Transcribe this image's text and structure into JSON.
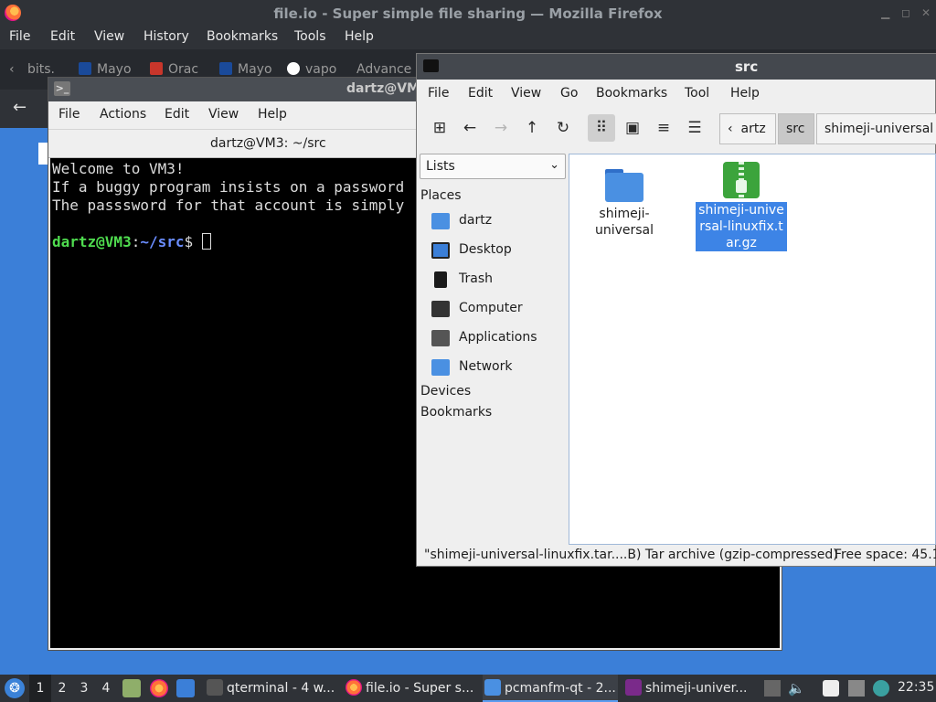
{
  "firefox": {
    "title": "file.io - Super simple file sharing — Mozilla Firefox",
    "menu": [
      "File",
      "Edit",
      "View",
      "History",
      "Bookmarks",
      "Tools",
      "Help"
    ],
    "tabs": [
      "bits.",
      "Mayo",
      "Orac",
      "Mayo",
      "vapo",
      "Advance"
    ]
  },
  "terminal": {
    "window_title": "dartz@VM",
    "menu": [
      "File",
      "Actions",
      "Edit",
      "View",
      "Help"
    ],
    "tab_title": "dartz@VM3: ~/src",
    "lines": [
      "Welcome to VM3!",
      "If a buggy program insists on a password",
      "The passsword for that account is simply"
    ],
    "prompt_user": "dartz@VM3",
    "prompt_sep": ":",
    "prompt_path": "~/src",
    "prompt_end": "$"
  },
  "filemanager": {
    "title": "src",
    "menu": [
      "File",
      "Edit",
      "View",
      "Go",
      "Bookmarks",
      "Tool",
      "Help"
    ],
    "breadcrumbs": [
      "artz",
      "src",
      "shimeji-universal"
    ],
    "side_view": "Lists",
    "sections": {
      "places": "Places",
      "devices": "Devices",
      "bookmarks": "Bookmarks"
    },
    "places": [
      {
        "label": "dartz",
        "icon": "home-folder-icon",
        "color": "#4a90e2"
      },
      {
        "label": "Desktop",
        "icon": "desktop-icon",
        "color": "#3b7fd8"
      },
      {
        "label": "Trash",
        "icon": "trash-icon",
        "color": "#1a1a1a"
      },
      {
        "label": "Computer",
        "icon": "computer-icon",
        "color": "#333333"
      },
      {
        "label": "Applications",
        "icon": "applications-icon",
        "color": "#555555"
      },
      {
        "label": "Network",
        "icon": "network-folder-icon",
        "color": "#4a90e2"
      }
    ],
    "files": [
      {
        "name": "shimeji-universal",
        "type": "folder"
      },
      {
        "name": "shimeji-universal-linuxfix.tar.gz",
        "type": "archive"
      }
    ],
    "status_left": "\"shimeji-universal-linuxfix.tar....B) Tar archive (gzip-compressed)",
    "status_right": "Free space: 45.1"
  },
  "taskbar": {
    "workspaces": [
      "1",
      "2",
      "3",
      "4"
    ],
    "tasks": [
      "qterminal - 4 w...",
      "file.io - Super s...",
      "pcmanfm-qt - 2...",
      "shimeji-univer..."
    ],
    "clock": "22:35"
  },
  "colors": {
    "desktop": "#3b7fd8",
    "selection": "#3d84e6",
    "prompt_user": "#4fdc4f",
    "prompt_path": "#6a8dff"
  }
}
